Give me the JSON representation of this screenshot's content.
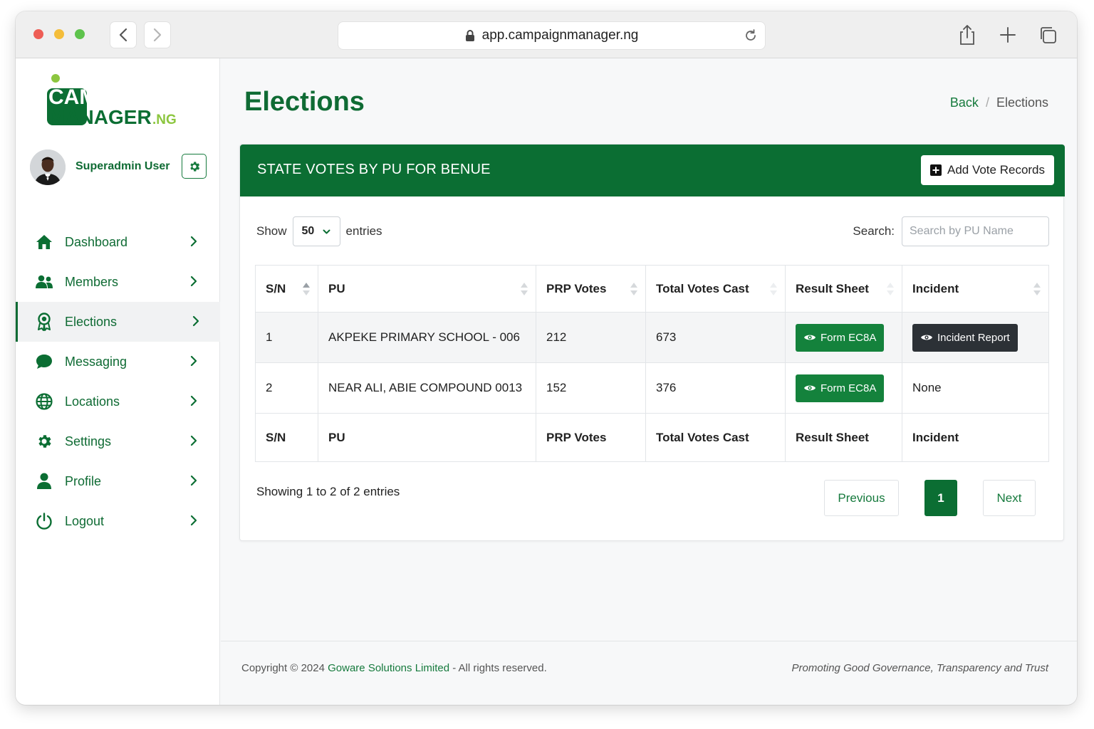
{
  "browser": {
    "url": "app.campaignmanager.ng"
  },
  "brand": {
    "logo_line1": "CAMPAIGN",
    "logo_line2": "MANAGER",
    "logo_suffix": ".NG",
    "primary_color": "#0b6e33",
    "accent_color": "#8cc63f"
  },
  "user": {
    "name": "Superadmin User"
  },
  "sidebar": {
    "items": [
      {
        "label": "Dashboard",
        "icon": "home-icon"
      },
      {
        "label": "Members",
        "icon": "users-icon"
      },
      {
        "label": "Elections",
        "icon": "award-icon",
        "active": true
      },
      {
        "label": "Messaging",
        "icon": "chat-icon"
      },
      {
        "label": "Locations",
        "icon": "globe-icon"
      },
      {
        "label": "Settings",
        "icon": "gear-icon"
      },
      {
        "label": "Profile",
        "icon": "user-icon"
      },
      {
        "label": "Logout",
        "icon": "power-icon"
      }
    ]
  },
  "page": {
    "title": "Elections",
    "breadcrumb": {
      "back": "Back",
      "separator": "/",
      "current": "Elections"
    }
  },
  "card": {
    "title": "STATE VOTES BY PU FOR BENUE",
    "add_button": "Add Vote Records"
  },
  "table_controls": {
    "show_label": "Show",
    "entries_value": "50",
    "entries_label": "entries",
    "search_label": "Search:",
    "search_placeholder": "Search by PU Name"
  },
  "table": {
    "columns": [
      "S/N",
      "PU",
      "PRP Votes",
      "Total Votes Cast",
      "Result Sheet",
      "Incident"
    ],
    "rows": [
      {
        "sn": "1",
        "pu": "AKPEKE PRIMARY SCHOOL - 006",
        "prp_votes": "212",
        "total_votes": "673",
        "result_sheet": "Form EC8A",
        "incident": "Incident Report"
      },
      {
        "sn": "2",
        "pu": "NEAR ALI, ABIE COMPOUND 0013",
        "prp_votes": "152",
        "total_votes": "376",
        "result_sheet": "Form EC8A",
        "incident": "None"
      }
    ]
  },
  "pagination": {
    "info": "Showing 1 to 2 of 2 entries",
    "previous": "Previous",
    "current": "1",
    "next": "Next"
  },
  "footer": {
    "copyright_prefix": "Copyright © 2024",
    "company": "Goware Solutions Limited",
    "copyright_suffix": "- All rights reserved.",
    "tagline": "Promoting Good Governance, Transparency and Trust"
  }
}
